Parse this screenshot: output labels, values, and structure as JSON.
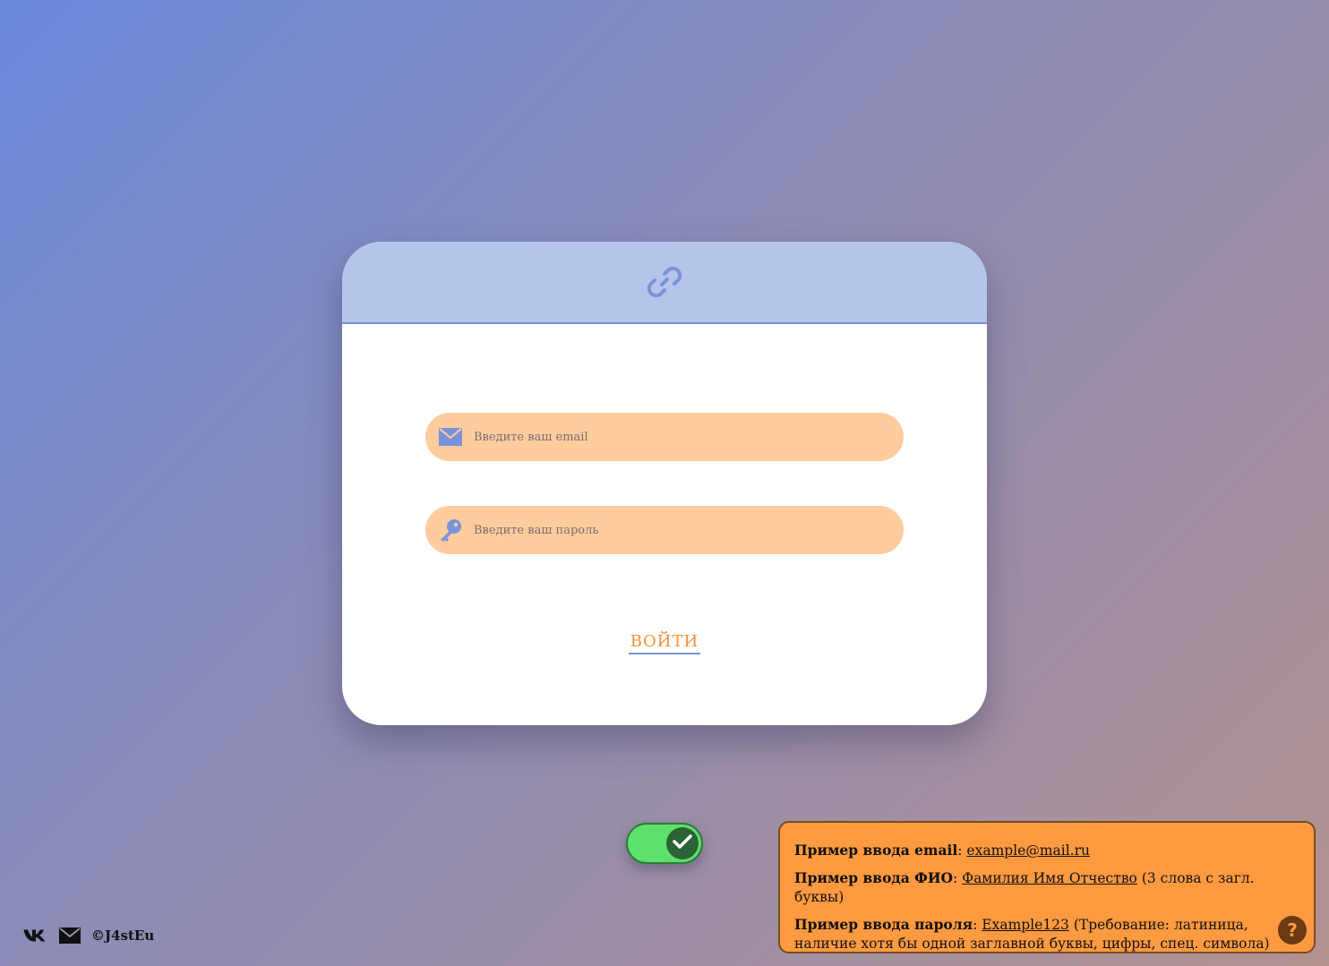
{
  "colors": {
    "header_bg": "#b5c4e9",
    "accent_blue": "#7a92db",
    "field_bg": "#ffcc9e",
    "login_text": "#f2913d",
    "toggle_on": "#5de06c",
    "hint_bg": "#ff9a40"
  },
  "card": {
    "header_icon": "link-icon",
    "email": {
      "icon": "envelope-icon",
      "placeholder": "Введите ваш email",
      "value": ""
    },
    "password": {
      "icon": "key-icon",
      "placeholder": "Введите ваш пароль",
      "value": ""
    },
    "login_label": "ВОЙТИ"
  },
  "toggle": {
    "state": "on",
    "icon": "check-icon"
  },
  "hint": {
    "email_label": "Пример ввода email",
    "email_example": "example@mail.ru",
    "fio_label": "Пример ввода ФИО",
    "fio_example": "Фамилия Имя Отчество",
    "fio_note": "(3 слова с загл. буквы)",
    "password_label": "Пример ввода пароля",
    "password_example": "Example123",
    "password_note": "(Требование: латиница, наличие хотя бы одной заглавной буквы, цифры, спец. символа)",
    "help_label": "?"
  },
  "footer": {
    "vk_icon": "vk-icon",
    "mail_icon": "mail-icon",
    "copyright": "©J4stEu"
  }
}
